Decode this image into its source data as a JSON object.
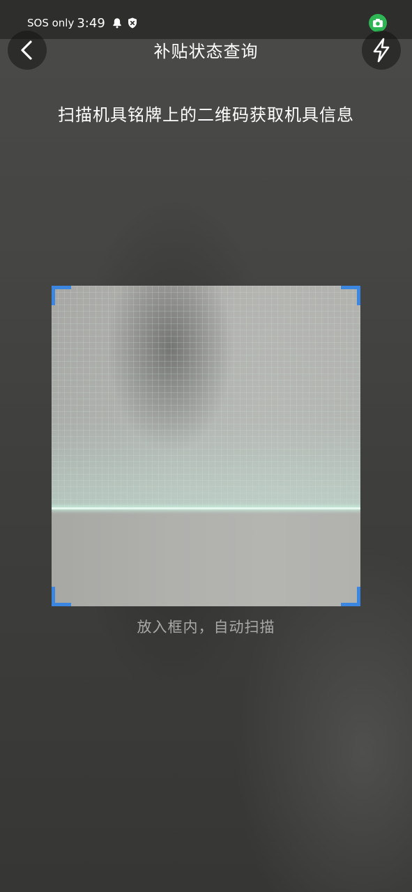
{
  "status_bar": {
    "network_text": "SOS only",
    "time": "3:49",
    "icons": [
      "bell-icon",
      "shield-icon",
      "camera-indicator-icon"
    ],
    "camera_indicator_color": "#2fb654"
  },
  "header": {
    "title": "补贴状态查询",
    "back_icon": "chevron-left-icon",
    "flash_icon": "flash-icon"
  },
  "scanner": {
    "instruction": "扫描机具铭牌上的二维码获取机具信息",
    "hint": "放入框内，自动扫描",
    "corner_color": "#3a86e0"
  }
}
